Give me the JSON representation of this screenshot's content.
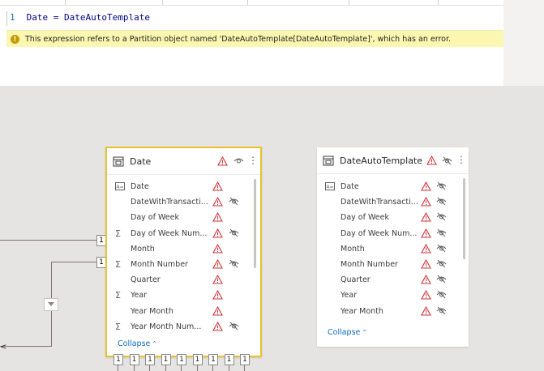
{
  "editor": {
    "line_number": "1",
    "code": "Date = DateAutoTemplate",
    "error_message": "This expression refers to a Partition object named 'DateAutoTemplate[DateAutoTemplate]', which has an error.",
    "error_icon": "!"
  },
  "relationship_markers": [
    "1",
    "1"
  ],
  "bottom_markers": [
    "1",
    "1",
    "1",
    "1",
    "1",
    "1",
    "1",
    "1",
    "1"
  ],
  "tables": [
    {
      "title": "Date",
      "selected": true,
      "fields": [
        {
          "name": "Date",
          "icon": "calendar-icon",
          "warning": true,
          "hidden": false
        },
        {
          "name": "DateWithTransacti...",
          "icon": "",
          "warning": true,
          "hidden": true
        },
        {
          "name": "Day of Week",
          "icon": "",
          "warning": true,
          "hidden": false
        },
        {
          "name": "Day of Week Num...",
          "icon": "sigma-icon",
          "warning": true,
          "hidden": true
        },
        {
          "name": "Month",
          "icon": "",
          "warning": true,
          "hidden": false
        },
        {
          "name": "Month Number",
          "icon": "sigma-icon",
          "warning": true,
          "hidden": true
        },
        {
          "name": "Quarter",
          "icon": "",
          "warning": true,
          "hidden": false
        },
        {
          "name": "Year",
          "icon": "sigma-icon",
          "warning": true,
          "hidden": false
        },
        {
          "name": "Year Month",
          "icon": "",
          "warning": true,
          "hidden": false
        },
        {
          "name": "Year Month Num...",
          "icon": "sigma-icon",
          "warning": true,
          "hidden": true
        }
      ],
      "collapse_label": "Collapse"
    },
    {
      "title": "DateAutoTemplate",
      "selected": false,
      "fields": [
        {
          "name": "Date",
          "icon": "calendar-icon",
          "warning": true,
          "hidden": true
        },
        {
          "name": "DateWithTransacti...",
          "icon": "",
          "warning": true,
          "hidden": true
        },
        {
          "name": "Day of Week",
          "icon": "",
          "warning": true,
          "hidden": true
        },
        {
          "name": "Day of Week Num...",
          "icon": "",
          "warning": true,
          "hidden": true
        },
        {
          "name": "Month",
          "icon": "",
          "warning": true,
          "hidden": true
        },
        {
          "name": "Month Number",
          "icon": "",
          "warning": true,
          "hidden": true
        },
        {
          "name": "Quarter",
          "icon": "",
          "warning": true,
          "hidden": true
        },
        {
          "name": "Year",
          "icon": "",
          "warning": true,
          "hidden": true
        },
        {
          "name": "Year Month",
          "icon": "",
          "warning": true,
          "hidden": true
        }
      ],
      "collapse_label": "Collapse"
    }
  ],
  "colors": {
    "warning": "#d13438",
    "selected_border": "#e8c12f",
    "link": "#0f6cbd",
    "error_bar": "#fbf7b1"
  }
}
